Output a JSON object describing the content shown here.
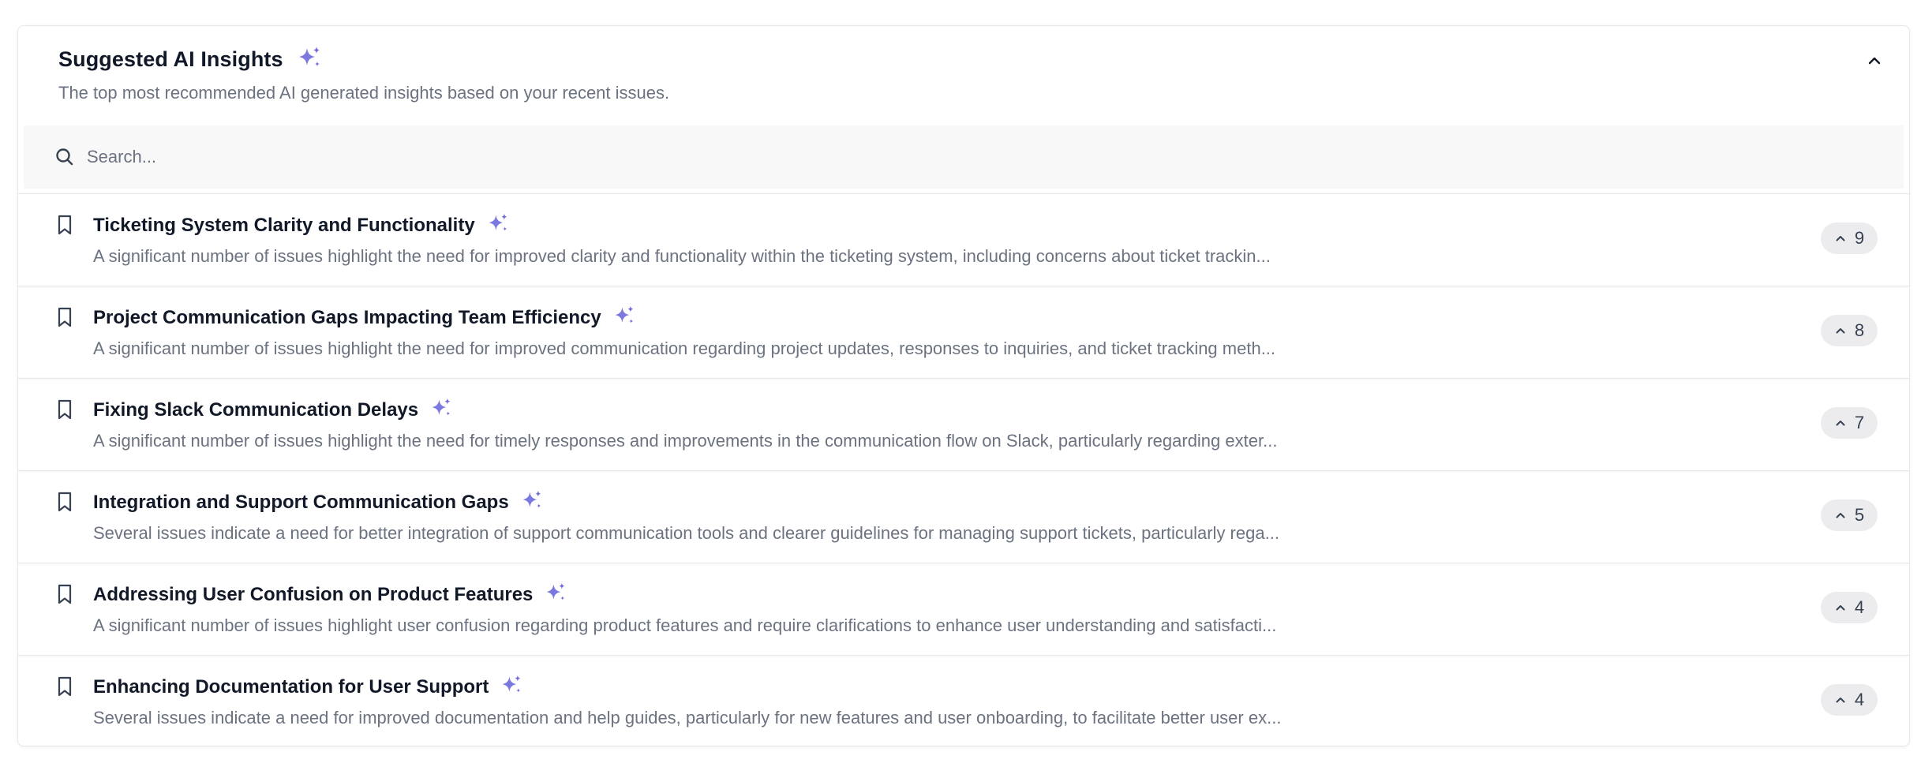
{
  "header": {
    "title": "Suggested AI Insights",
    "subtitle": "The top most recommended AI generated insights based on your recent issues."
  },
  "search": {
    "placeholder": "Search..."
  },
  "colors": {
    "sparkle": "#6f6ad8",
    "text_primary": "#111827",
    "text_secondary": "#6b7280",
    "pill_bg": "#ececee"
  },
  "icons": {
    "sparkle": "sparkles-icon",
    "bookmark": "bookmark-icon",
    "collapse": "chevron-up-icon",
    "search": "search-icon",
    "vote": "chevron-up-icon"
  },
  "insights": [
    {
      "title": "Ticketing System Clarity and Functionality",
      "description": "A significant number of issues highlight the need for improved clarity and functionality within the ticketing system, including concerns about ticket trackin...",
      "count": "9"
    },
    {
      "title": "Project Communication Gaps Impacting Team Efficiency",
      "description": "A significant number of issues highlight the need for improved communication regarding project updates, responses to inquiries, and ticket tracking meth...",
      "count": "8"
    },
    {
      "title": "Fixing Slack Communication Delays",
      "description": "A significant number of issues highlight the need for timely responses and improvements in the communication flow on Slack, particularly regarding exter...",
      "count": "7"
    },
    {
      "title": "Integration and Support Communication Gaps",
      "description": "Several issues indicate a need for better integration of support communication tools and clearer guidelines for managing support tickets, particularly rega...",
      "count": "5"
    },
    {
      "title": "Addressing User Confusion on Product Features",
      "description": "A significant number of issues highlight user confusion regarding product features and require clarifications to enhance user understanding and satisfacti...",
      "count": "4"
    },
    {
      "title": "Enhancing Documentation for User Support",
      "description": "Several issues indicate a need for improved documentation and help guides, particularly for new features and user onboarding, to facilitate better user ex...",
      "count": "4"
    }
  ]
}
